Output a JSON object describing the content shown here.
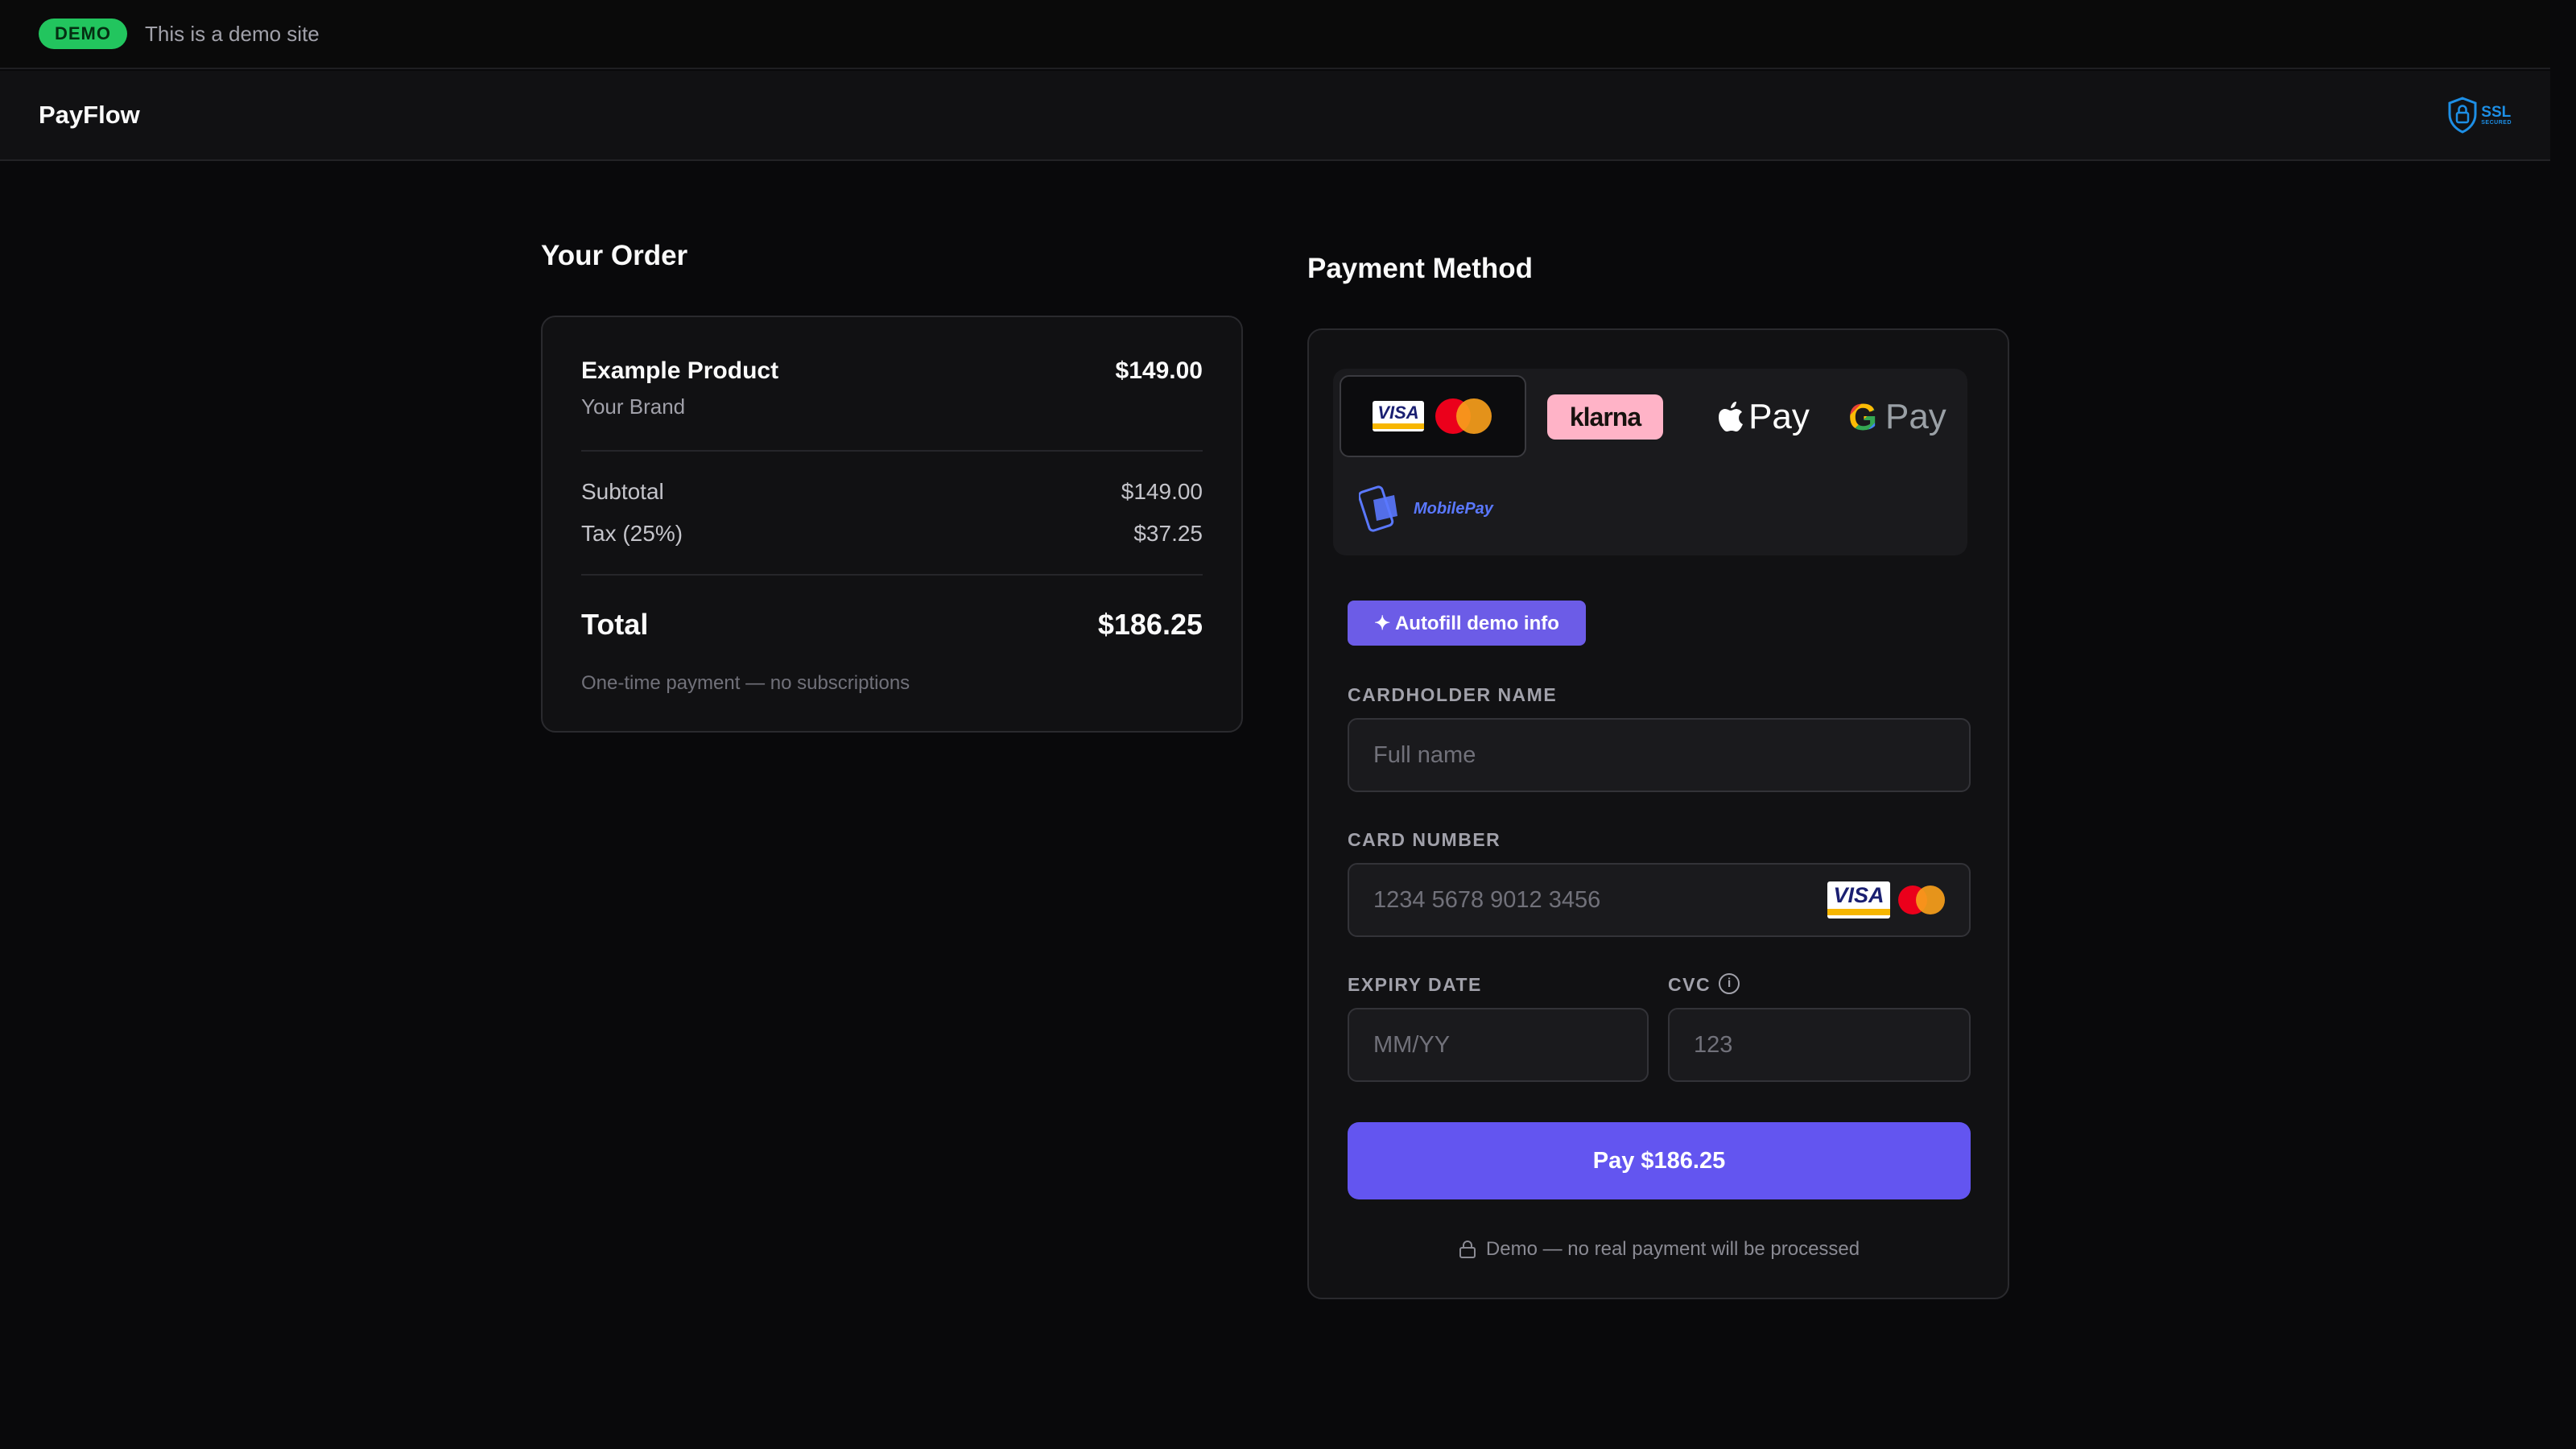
{
  "banner": {
    "badge": "DEMO",
    "text": "This is a demo site"
  },
  "nav": {
    "brand": "PayFlow",
    "ssl_label": "SSL",
    "ssl_sub": "SECURED"
  },
  "order": {
    "title": "Your Order",
    "product_name": "Example Product",
    "product_price": "$149.00",
    "product_brand": "Your Brand",
    "subtotal_label": "Subtotal",
    "subtotal_value": "$149.00",
    "tax_label": "Tax (25%)",
    "tax_value": "$37.25",
    "total_label": "Total",
    "total_value": "$186.25",
    "note": "One-time payment — no subscriptions"
  },
  "payment": {
    "title": "Payment Method",
    "methods": {
      "card_visa": "VISA",
      "klarna": "klarna",
      "apple_pay": "Pay",
      "google_pay": "Pay",
      "google_g": "G",
      "mobilepay": "MobilePay"
    },
    "autofill_label": "✦ Autofill demo info",
    "cardholder_label": "CARDHOLDER NAME",
    "cardholder_placeholder": "Full name",
    "card_number_label": "CARD NUMBER",
    "card_number_placeholder": "1234 5678 9012 3456",
    "expiry_label": "EXPIRY DATE",
    "expiry_placeholder": "MM/YY",
    "cvc_label": "CVC",
    "cvc_info": "i",
    "cvc_placeholder": "123",
    "pay_button": "Pay $186.25",
    "footer_note": "Demo — no real payment will be processed"
  },
  "colors": {
    "background": "#09090b",
    "accent": "#6355f0",
    "demo_badge": "#22c55e",
    "klarna_pink": "#ffb3c7",
    "ssl_blue": "#1d8fe6"
  }
}
